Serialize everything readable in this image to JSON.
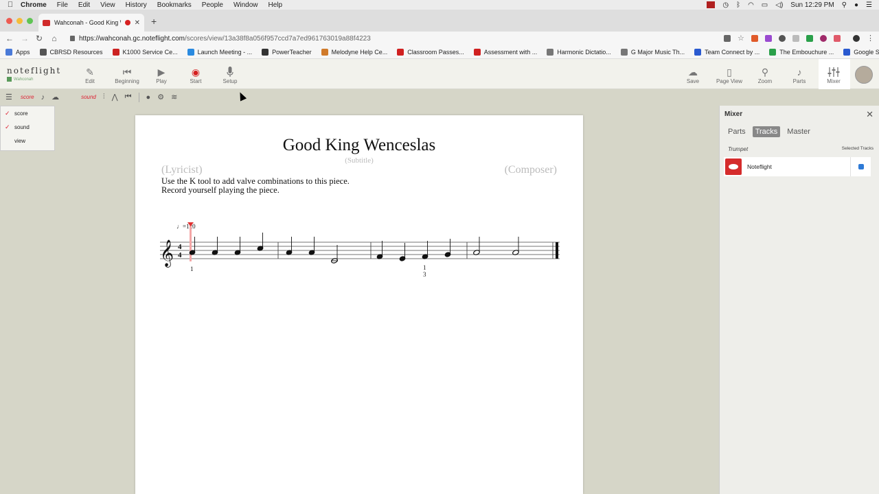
{
  "menubar": {
    "app": "Chrome",
    "items": [
      "File",
      "Edit",
      "View",
      "History",
      "Bookmarks",
      "People",
      "Window",
      "Help"
    ],
    "clock": "Sun 12:29 PM"
  },
  "browser": {
    "tab_title": "Wahconah - Good King We",
    "url_host": "https://wahconah.gc.noteflight.com",
    "url_path": "/scores/view/13a38f8a056f957ccd7a7ed961763019a88f4223"
  },
  "bookmarks": [
    {
      "label": "Apps",
      "color": "#4a7ad8"
    },
    {
      "label": "CBRSD Resources",
      "color": "#555555"
    },
    {
      "label": "K1000 Service Ce...",
      "color": "#cc2222"
    },
    {
      "label": "Launch Meeting - ...",
      "color": "#2a8ae0"
    },
    {
      "label": "PowerTeacher",
      "color": "#333333"
    },
    {
      "label": "Melodyne Help Ce...",
      "color": "#d07a2a"
    },
    {
      "label": "Classroom Passes...",
      "color": "#d02020"
    },
    {
      "label": "Assessment with ...",
      "color": "#d02020"
    },
    {
      "label": "Harmonic Dictatio...",
      "color": "#777777"
    },
    {
      "label": "G Major Music Th...",
      "color": "#777777"
    },
    {
      "label": "Team Connect by ...",
      "color": "#2a5ad0"
    },
    {
      "label": "The Embouchure ...",
      "color": "#2aa04a"
    },
    {
      "label": "Google Suite",
      "color": "#2a5ad0"
    }
  ],
  "noteflight": {
    "logo": "noteflight",
    "group": "Wahconah",
    "left_buttons": [
      {
        "label": "Edit",
        "icon": "pencil-icon",
        "glyph": "✎"
      },
      {
        "label": "Beginning",
        "icon": "skip-back-icon",
        "glyph": "⏮"
      },
      {
        "label": "Play",
        "icon": "play-icon",
        "glyph": "▶"
      },
      {
        "label": "Start",
        "icon": "record-icon",
        "glyph": "◉"
      },
      {
        "label": "Setup",
        "icon": "microphone-icon",
        "glyph": "🎤"
      }
    ],
    "right_buttons": [
      {
        "label": "Save",
        "icon": "cloud-upload-icon",
        "glyph": "☁"
      },
      {
        "label": "Page View",
        "icon": "page-icon",
        "glyph": "▯"
      },
      {
        "label": "Zoom",
        "icon": "magnifier-icon",
        "glyph": "⚲"
      },
      {
        "label": "Parts",
        "icon": "guitar-icon",
        "glyph": "♪"
      },
      {
        "label": "Mixer",
        "icon": "mixer-icon",
        "glyph": "⫶"
      }
    ]
  },
  "subtoolbar": {
    "score_label": "score",
    "sound_label": "sound"
  },
  "left_menu": [
    {
      "label": "score",
      "checked": true
    },
    {
      "label": "sound",
      "checked": true
    },
    {
      "label": "view",
      "checked": false
    }
  ],
  "score": {
    "title": "Good King Wenceslas",
    "subtitle": "(Subtitle)",
    "lyricist": "(Lyricist)",
    "composer": "(Composer)",
    "instructions_line1": "Use the K tool to add valve combinations to this piece.",
    "instructions_line2": "Record yourself playing the piece.",
    "tempo": "♩=120",
    "time_signature_top": "4",
    "time_signature_bottom": "4",
    "fingering_1": "1",
    "fingering_2_top": "1",
    "fingering_2_bottom": "3"
  },
  "mixer": {
    "title": "Mixer",
    "tabs": [
      "Parts",
      "Tracks",
      "Master"
    ],
    "active_tab": "Tracks",
    "track_heading": "Trumpet",
    "selected_heading": "Selected Tracks",
    "track_name": "Noteflight",
    "track_selected": true
  }
}
